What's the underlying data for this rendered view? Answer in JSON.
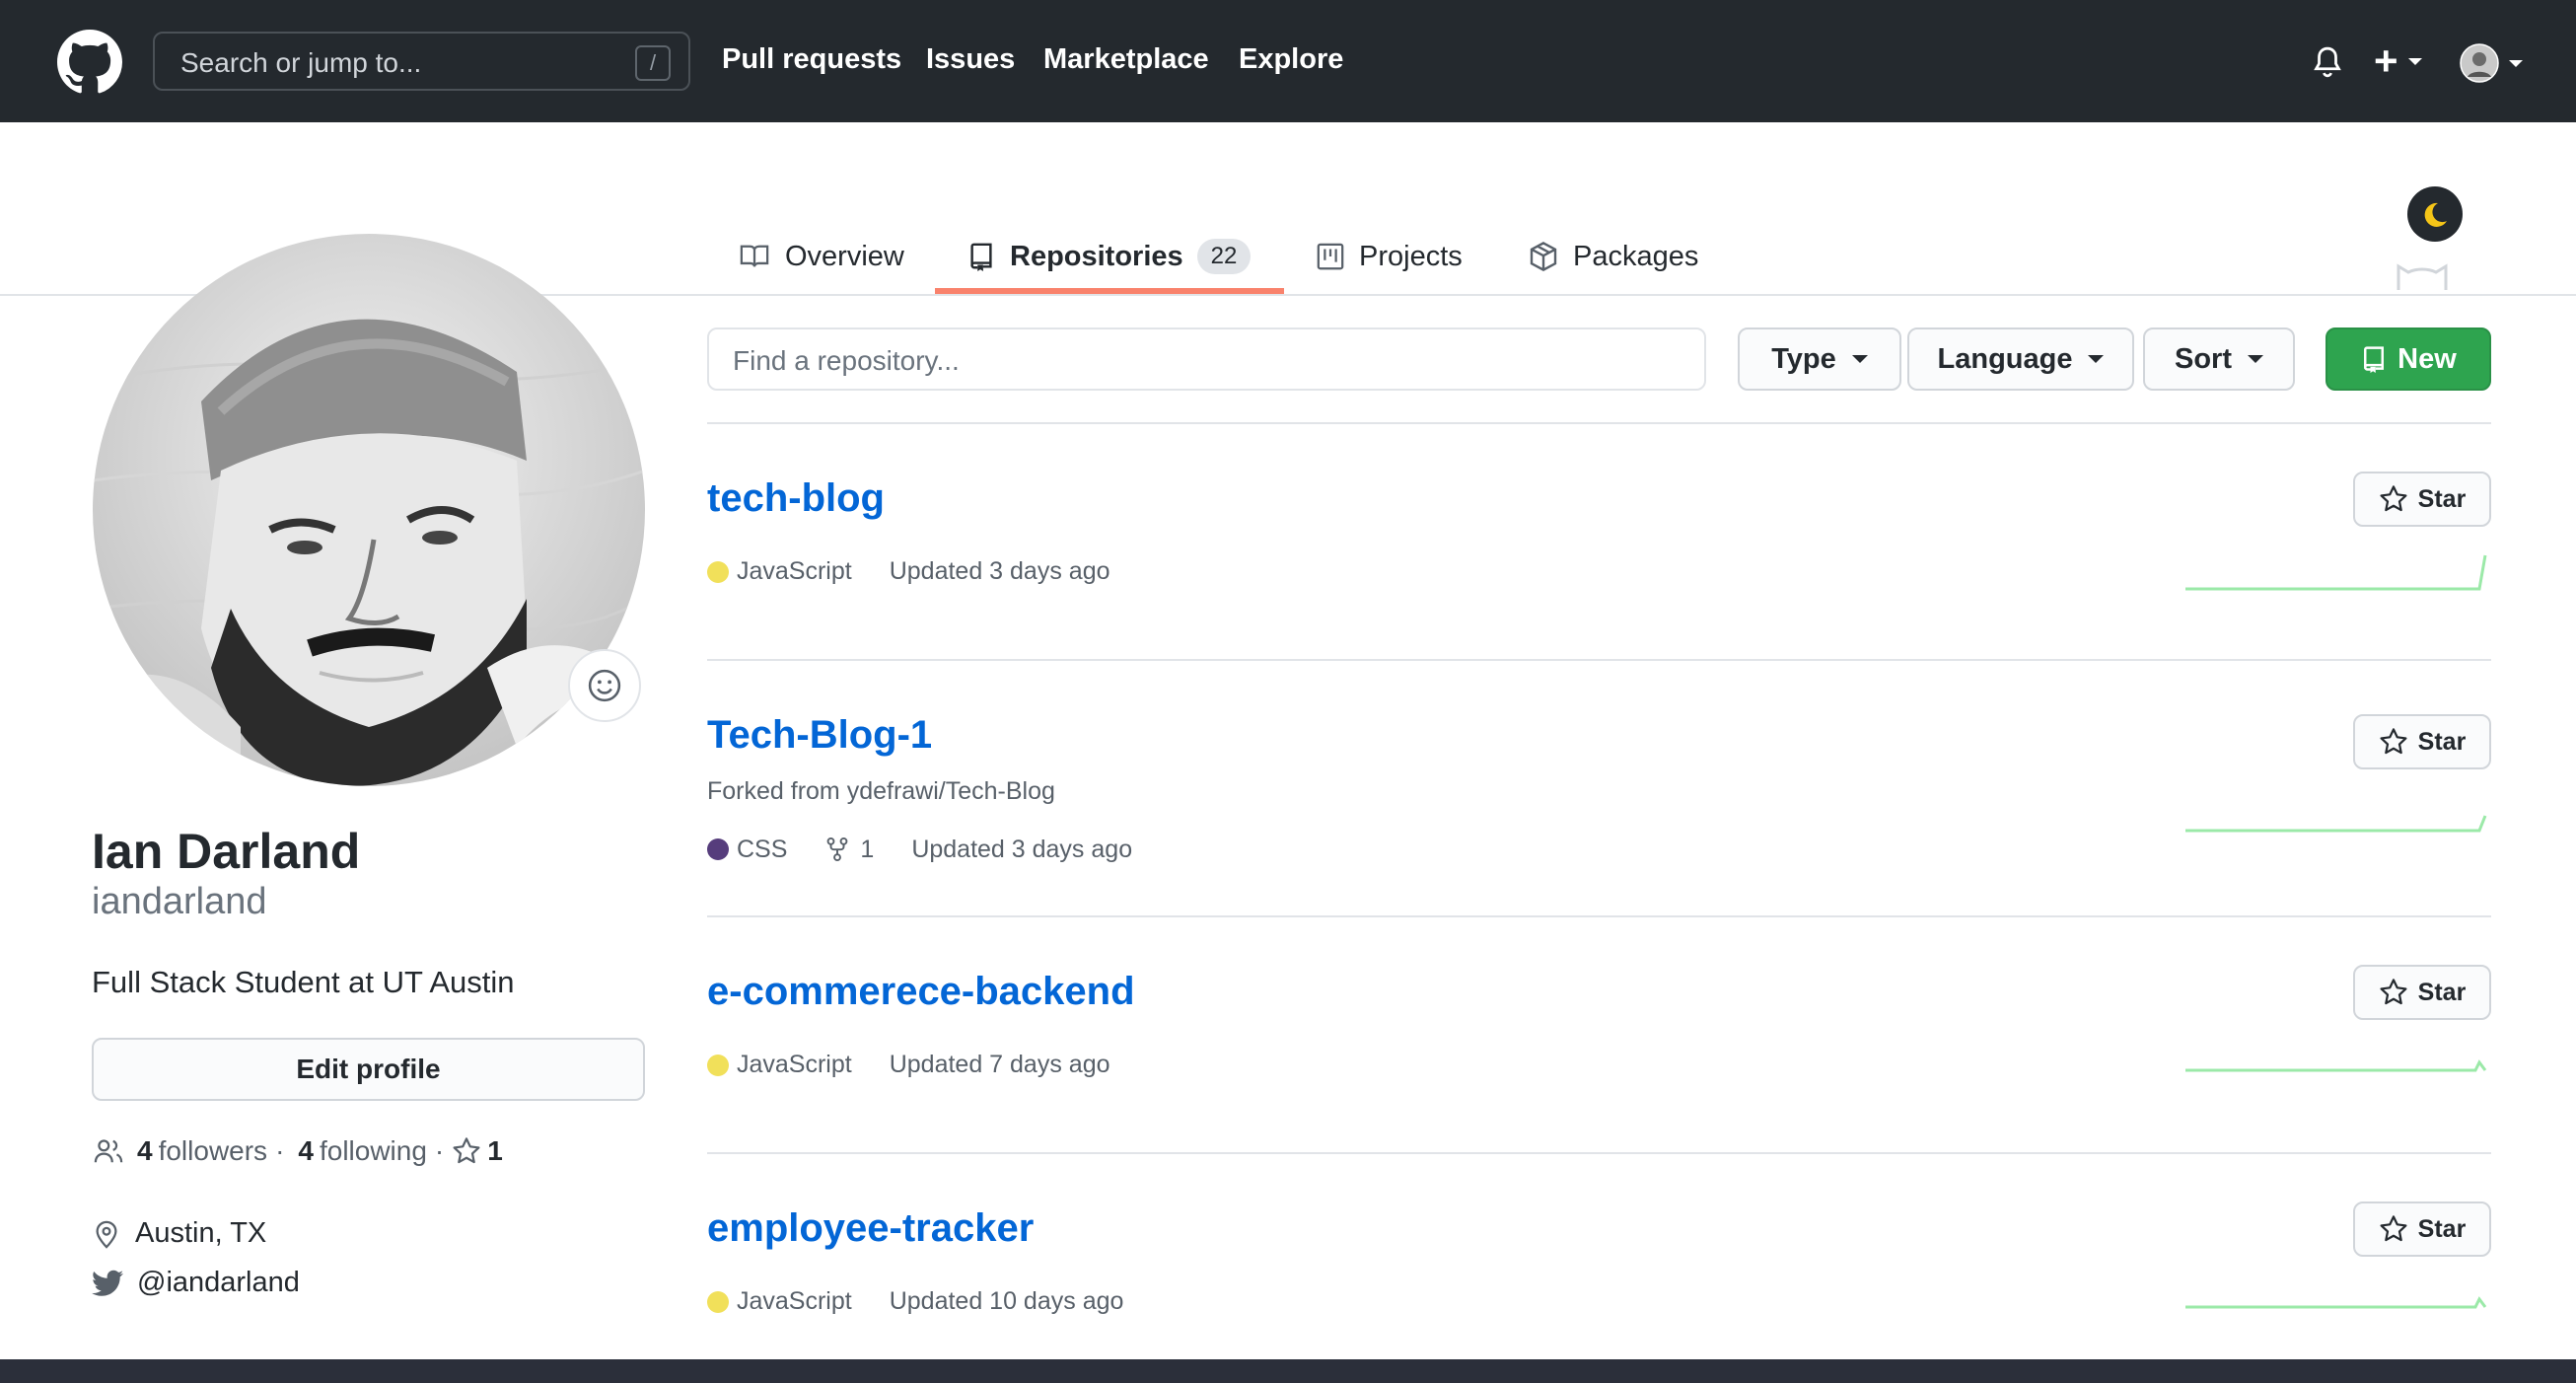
{
  "header": {
    "search_placeholder": "Search or jump to...",
    "search_shortcut": "/",
    "nav": [
      "Pull requests",
      "Issues",
      "Marketplace",
      "Explore"
    ],
    "plus_label": "+"
  },
  "tabs": [
    {
      "label": "Overview"
    },
    {
      "label": "Repositories",
      "count": "22"
    },
    {
      "label": "Projects"
    },
    {
      "label": "Packages"
    }
  ],
  "profile": {
    "name": "Ian Darland",
    "login": "iandarland",
    "bio": "Full Stack Student at UT Austin",
    "edit_label": "Edit profile",
    "followers_count": "4",
    "followers_label": "followers",
    "following_count": "4",
    "following_label": "following",
    "stars_count": "1",
    "location": "Austin, TX",
    "twitter": "@iandarland"
  },
  "repo_filters": {
    "find_placeholder": "Find a repository...",
    "type_label": "Type",
    "language_label": "Language",
    "sort_label": "Sort",
    "new_label": "New"
  },
  "repos": [
    {
      "name": "tech-blog",
      "language": "JavaScript",
      "language_color": "#f1e05a",
      "updated": "Updated 3 days ago",
      "star_label": "Star"
    },
    {
      "name": "Tech-Blog-1",
      "fork_note": "Forked from ydefrawi/Tech-Blog",
      "language": "CSS",
      "language_color": "#563d7c",
      "forks": "1",
      "updated": "Updated 3 days ago",
      "star_label": "Star"
    },
    {
      "name": "e-commerece-backend",
      "language": "JavaScript",
      "language_color": "#f1e05a",
      "updated": "Updated 7 days ago",
      "star_label": "Star"
    },
    {
      "name": "employee-tracker",
      "language": "JavaScript",
      "language_color": "#f1e05a",
      "updated": "Updated 10 days ago",
      "star_label": "Star"
    }
  ],
  "colors": {
    "header_bg": "#24292e",
    "link": "#0366d6",
    "accent_tab": "#f9826c",
    "new_button": "#2ea44f",
    "sparkline": "#9be9a8"
  }
}
